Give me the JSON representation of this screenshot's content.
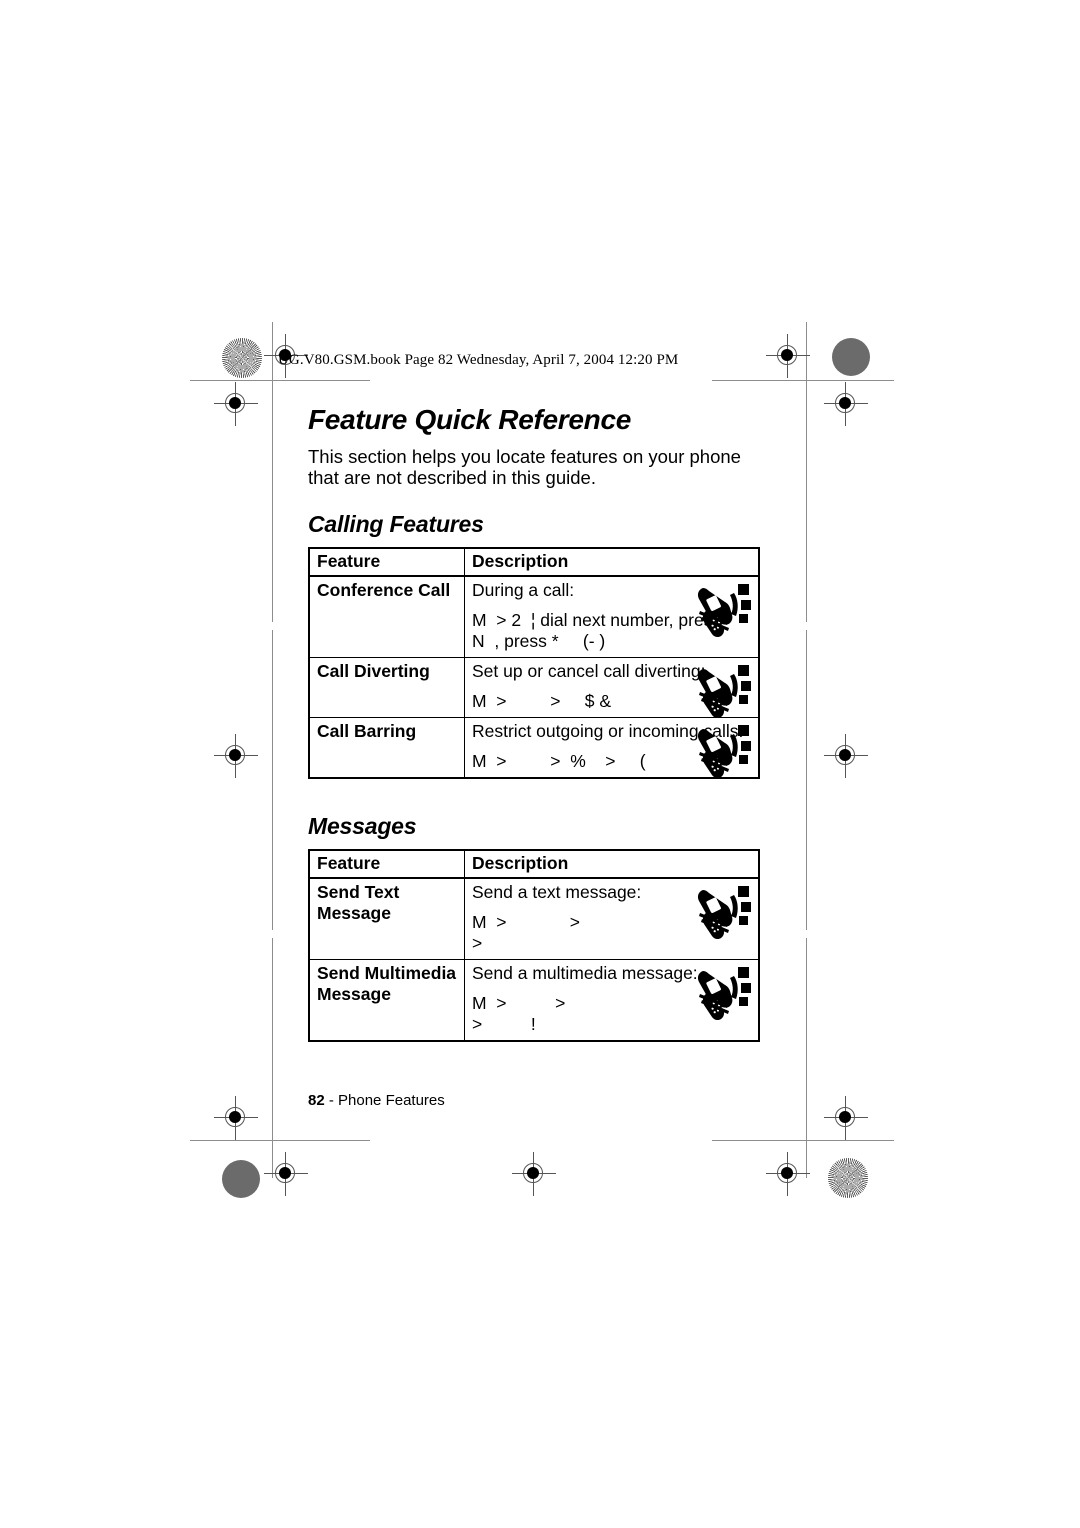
{
  "document": {
    "slug": "UG.V80.GSM.book  Page 82  Wednesday, April 7, 2004  12:20 PM",
    "page_title": "Feature Quick Reference",
    "intro": "This section helps you locate features on your phone that are not described in this guide.",
    "footer_page_number": "82",
    "footer_text": "- Phone Features"
  },
  "sections": [
    {
      "title": "Calling Features",
      "table": {
        "headers": [
          "Feature",
          "Description"
        ],
        "rows": [
          {
            "feature": "Conference Call",
            "desc_head": "During a call:",
            "desc_lines": [
              "M  > 2  ¦ dial next number, press",
              "N  , press *     (- )"
            ],
            "icon": "phone-flip-icon"
          },
          {
            "feature": "Call Diverting",
            "desc_head": "Set up or cancel call diverting:",
            "desc_lines": [
              "M  >         >     $ &"
            ],
            "icon": "phone-flip-icon"
          },
          {
            "feature": "Call Barring",
            "desc_head": "Restrict outgoing or incoming calls:",
            "desc_lines": [
              "M  >         >  %    >     ("
            ],
            "icon": "phone-flip-icon"
          }
        ]
      }
    },
    {
      "title": "Messages",
      "table": {
        "headers": [
          "Feature",
          "Description"
        ],
        "rows": [
          {
            "feature": "Send Text Message",
            "desc_head": "Send a text message:",
            "desc_lines": [
              "M  >             >",
              ">"
            ],
            "icon": "phone-flip-icon"
          },
          {
            "feature": "Send Multimedia Message",
            "desc_head": "Send a multimedia message:",
            "desc_lines": [
              "M  >          >",
              ">          !"
            ],
            "icon": "phone-flip-icon"
          }
        ]
      }
    }
  ]
}
